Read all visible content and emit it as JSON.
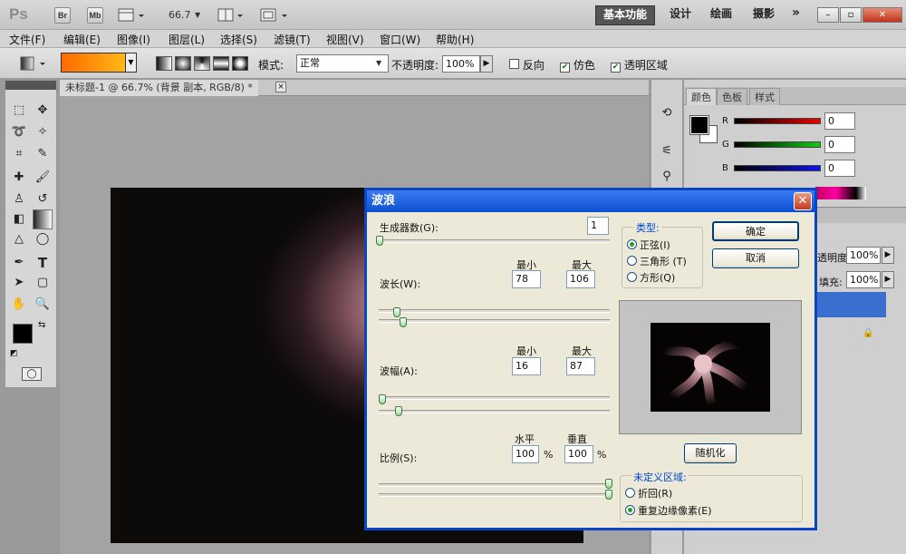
{
  "app": {
    "logo": "Ps",
    "bridge": "Br",
    "mini_bridge": "Mb",
    "zoom": "66.7",
    "workspaces": [
      "基本功能",
      "设计",
      "绘画",
      "摄影"
    ],
    "more": "»",
    "win_min": "–",
    "win_max": "▫",
    "win_close": "✕"
  },
  "menu": [
    "文件(F)",
    "编辑(E)",
    "图像(I)",
    "图层(L)",
    "选择(S)",
    "滤镜(T)",
    "视图(V)",
    "窗口(W)",
    "帮助(H)"
  ],
  "options": {
    "mode_label": "模式:",
    "mode_value": "正常",
    "opacity_label": "不透明度:",
    "opacity_value": "100%",
    "reverse": "反向",
    "dither": "仿色",
    "transparency": "透明区域",
    "checks": {
      "reverse": false,
      "dither": true,
      "transparency": true
    },
    "gradient_colors": [
      "#ff6a00",
      "#ffc21a"
    ]
  },
  "document": {
    "tab_title": "未标题-1 @ 66.7% (背景 副本, RGB/8) *",
    "tab_close": "×"
  },
  "right_panel": {
    "tabs": [
      "颜色",
      "色板",
      "样式"
    ],
    "channels": [
      {
        "label": "R",
        "value": "0"
      },
      {
        "label": "G",
        "value": "0"
      },
      {
        "label": "B",
        "value": "0"
      }
    ],
    "opacity_label": "透明度:",
    "opacity_value": "100%",
    "fill_label": "填充:",
    "fill_value": "100%"
  },
  "dialog": {
    "title": "波浪",
    "close": "✕",
    "generators_label": "生成器数(G):",
    "generators_value": "1",
    "min_label": "最小",
    "max_label": "最大",
    "wavelength_label": "波长(W):",
    "wavelength_min": "78",
    "wavelength_max": "106",
    "amplitude_label": "波幅(A):",
    "amplitude_min": "16",
    "amplitude_max": "87",
    "scale_label": "比例(S):",
    "horizontal_label": "水平",
    "vertical_label": "垂直",
    "scale_h": "100",
    "scale_v": "100",
    "percent": "%",
    "type_label": "类型:",
    "types": [
      "正弦(I)",
      "三角形 (T)",
      "方形(Q)"
    ],
    "type_selected": 0,
    "ok": "确定",
    "cancel": "取消",
    "randomize": "随机化",
    "undefined_label": "未定义区域:",
    "undefined_options": [
      "折回(R)",
      "重复边缘像素(E)"
    ],
    "undefined_selected": 1
  }
}
